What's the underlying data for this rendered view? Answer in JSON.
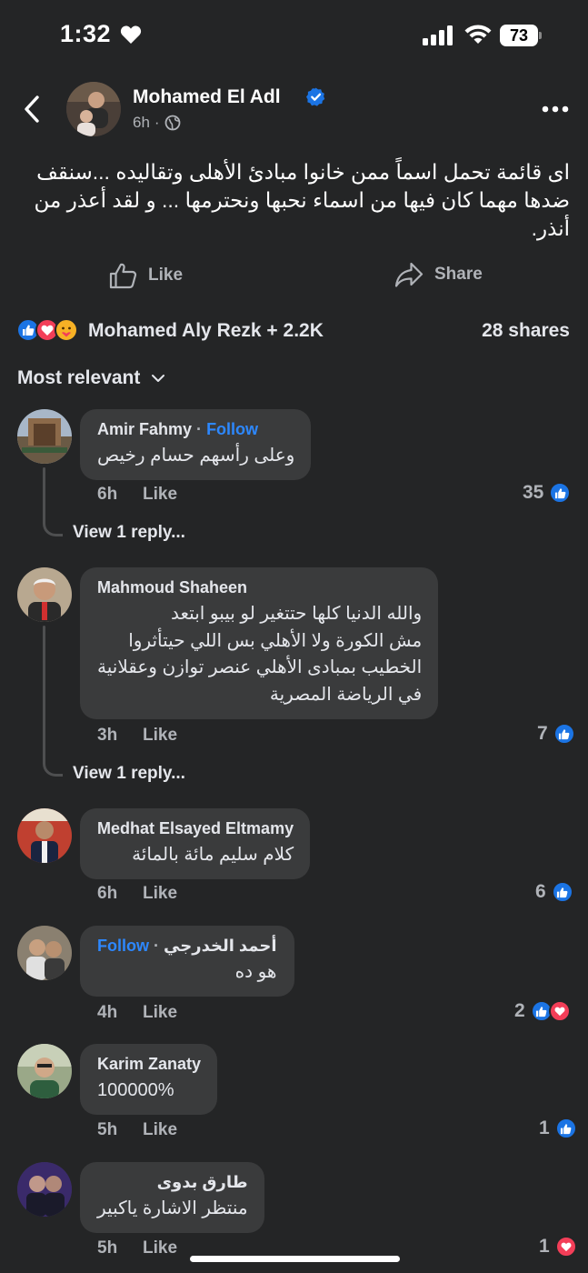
{
  "status_bar": {
    "time": "1:32",
    "battery": "73"
  },
  "post": {
    "author": "Mohamed El Adl",
    "time": "6h",
    "text": "اى قائمة تحمل اسماً ممن خانوا مبادئ الأهلى وتقاليده ...سنقف ضدها مهما كان فيها من اسماء نحبها ونحترمها ... و لقد أعذر من أنذر."
  },
  "actions": {
    "like_label": "Like",
    "share_label": "Share"
  },
  "reactions": {
    "summary": "Mohamed Aly Rezk + 2.2K",
    "shares": "28 shares",
    "types": [
      "like",
      "love",
      "care"
    ]
  },
  "sort": {
    "label": "Most relevant"
  },
  "comments": [
    {
      "name": "Amir Fahmy",
      "separator": "·",
      "follow": "Follow",
      "text": "وعلى رأسهم حسام رخيص",
      "time": "6h",
      "like_label": "Like",
      "count": "35",
      "reactions": [
        "like"
      ],
      "view_replies": "View 1 reply..."
    },
    {
      "name": "Mahmoud Shaheen",
      "text_lines": [
        "والله الدنيا كلها حتتغير لو بيبو ابتعد",
        "مش الكورة ولا الأهلي بس اللي حيتأثروا",
        "الخطيب بمبادى الأهلي عنصر توازن وعقلانية",
        "في الرياضة المصرية"
      ],
      "time": "3h",
      "like_label": "Like",
      "count": "7",
      "reactions": [
        "like"
      ],
      "view_replies": "View 1 reply..."
    },
    {
      "name": "Medhat Elsayed Eltmamy",
      "text": "كلام سليم مائة بالمائة",
      "time": "6h",
      "like_label": "Like",
      "count": "6",
      "reactions": [
        "like"
      ]
    },
    {
      "name": "أحمد  الخدرجي",
      "separator": "·",
      "follow": "Follow",
      "text": "هو ده",
      "time": "4h",
      "like_label": "Like",
      "count": "2",
      "reactions": [
        "like",
        "love"
      ]
    },
    {
      "name": "Karim Zanaty",
      "text": "100000%",
      "time": "5h",
      "like_label": "Like",
      "count": "1",
      "reactions": [
        "like"
      ]
    },
    {
      "name": "طارق بدوى",
      "text": "منتظر الاشارة ياكبير",
      "time": "5h",
      "like_label": "Like",
      "count": "1",
      "reactions": [
        "love"
      ]
    }
  ],
  "colors": {
    "background": "#242526",
    "bubble": "#3a3b3c",
    "accent": "#2d88ff",
    "like": "#1b74e4",
    "love": "#f33e58"
  }
}
